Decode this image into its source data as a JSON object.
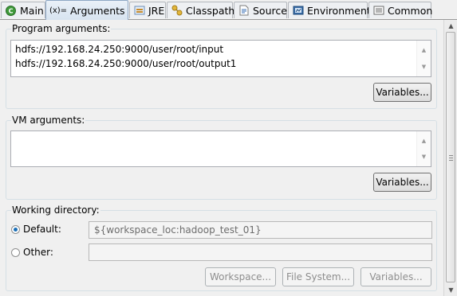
{
  "tabs": [
    {
      "label": "Main",
      "icon": "main-icon",
      "active": false
    },
    {
      "label": "Arguments",
      "icon": "arguments-icon",
      "active": true,
      "icon_text": "(x)="
    },
    {
      "label": "JRE",
      "icon": "jre-icon",
      "active": false
    },
    {
      "label": "Classpath",
      "icon": "classpath-icon",
      "active": false
    },
    {
      "label": "Source",
      "icon": "source-icon",
      "active": false
    },
    {
      "label": "Environment",
      "icon": "environment-icon",
      "active": false
    },
    {
      "label": "Common",
      "icon": "common-icon",
      "active": false
    }
  ],
  "program_arguments": {
    "title": "Program arguments:",
    "lines": [
      "hdfs://192.168.24.250:9000/user/root/input",
      "hdfs://192.168.24.250:9000/user/root/output1"
    ],
    "variables_button": "Variables..."
  },
  "vm_arguments": {
    "title": "VM arguments:",
    "value": "",
    "variables_button": "Variables..."
  },
  "working_directory": {
    "title": "Working directory:",
    "default_label": "Default:",
    "default_value": "${workspace_loc:hadoop_test_01}",
    "default_selected": true,
    "other_label": "Other:",
    "other_value": "",
    "other_selected": false,
    "workspace_button": "Workspace...",
    "filesystem_button": "File System...",
    "variables_button": "Variables..."
  },
  "colors": {
    "accent": "#1b6fb7",
    "active_tab": "#d7e3f0",
    "group_border": "#d5dfe5"
  }
}
